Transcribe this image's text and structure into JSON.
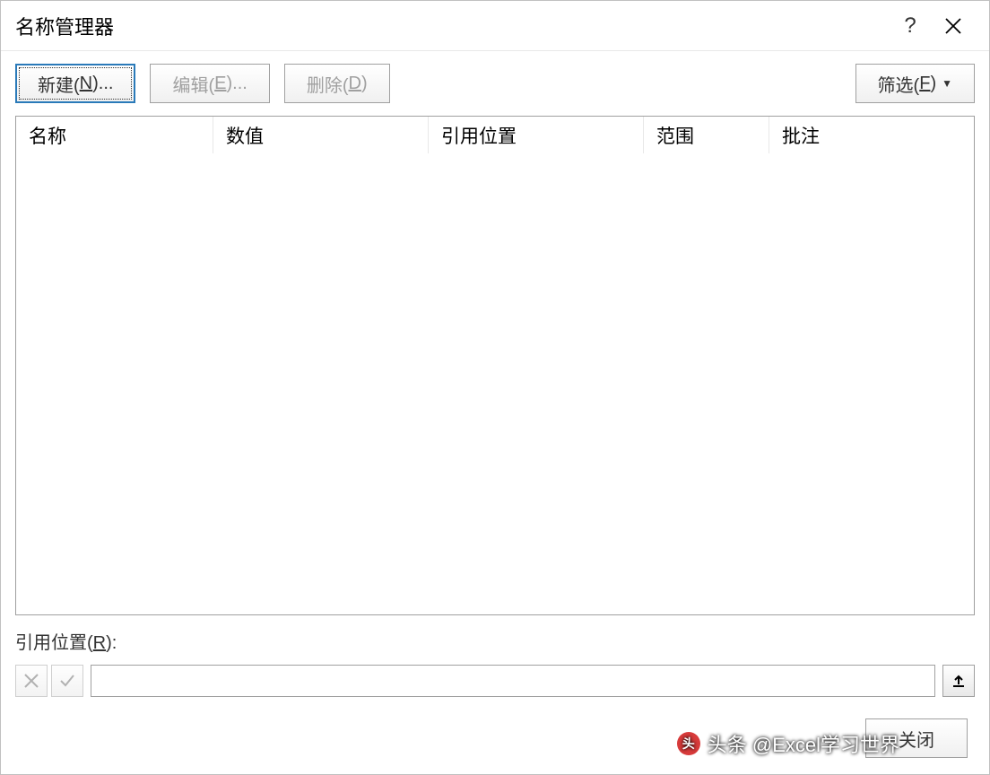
{
  "titlebar": {
    "title": "名称管理器",
    "help_char": "?",
    "close_label": "关闭窗口"
  },
  "toolbar": {
    "new_prefix": "新建(",
    "new_key": "N",
    "new_suffix": ")...",
    "edit_prefix": "编辑(",
    "edit_key": "E",
    "edit_suffix": ")...",
    "delete_prefix": "删除(",
    "delete_key": "D",
    "delete_suffix": ")",
    "filter_prefix": "筛选(",
    "filter_key": "F",
    "filter_suffix": ")"
  },
  "table": {
    "headers": {
      "name": "名称",
      "value": "数值",
      "refers_to": "引用位置",
      "scope": "范围",
      "comment": "批注"
    },
    "rows": []
  },
  "ref_section": {
    "label_prefix": "引用位置(",
    "label_key": "R",
    "label_suffix": "):",
    "input_value": ""
  },
  "footer": {
    "close_label": "关闭"
  },
  "watermark": {
    "text": "头条 @Excel学习世界"
  }
}
